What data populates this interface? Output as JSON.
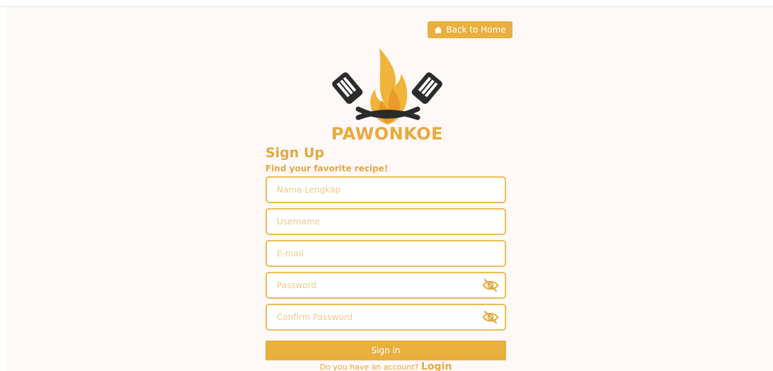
{
  "header": {
    "back_label": "Back to Home"
  },
  "brand": {
    "name": "PAWONKOE",
    "accent_color": "#e9b03e",
    "logo_icon": "spatula-flame-logo"
  },
  "form": {
    "title": "Sign Up",
    "subtitle": "Find your favorite recipe!",
    "fields": {
      "fullname": {
        "placeholder": "Nama Lengkap",
        "value": ""
      },
      "username": {
        "placeholder": "Username",
        "value": ""
      },
      "email": {
        "placeholder": "E-mail",
        "value": ""
      },
      "password": {
        "placeholder": "Password",
        "value": "",
        "toggle_icon": "eye-slash-icon"
      },
      "confirm_password": {
        "placeholder": "Confirm Password",
        "value": "",
        "toggle_icon": "eye-slash-icon"
      }
    },
    "submit_label": "Sign in",
    "footer_prompt": "Do you have an account?",
    "footer_link": "Login"
  }
}
